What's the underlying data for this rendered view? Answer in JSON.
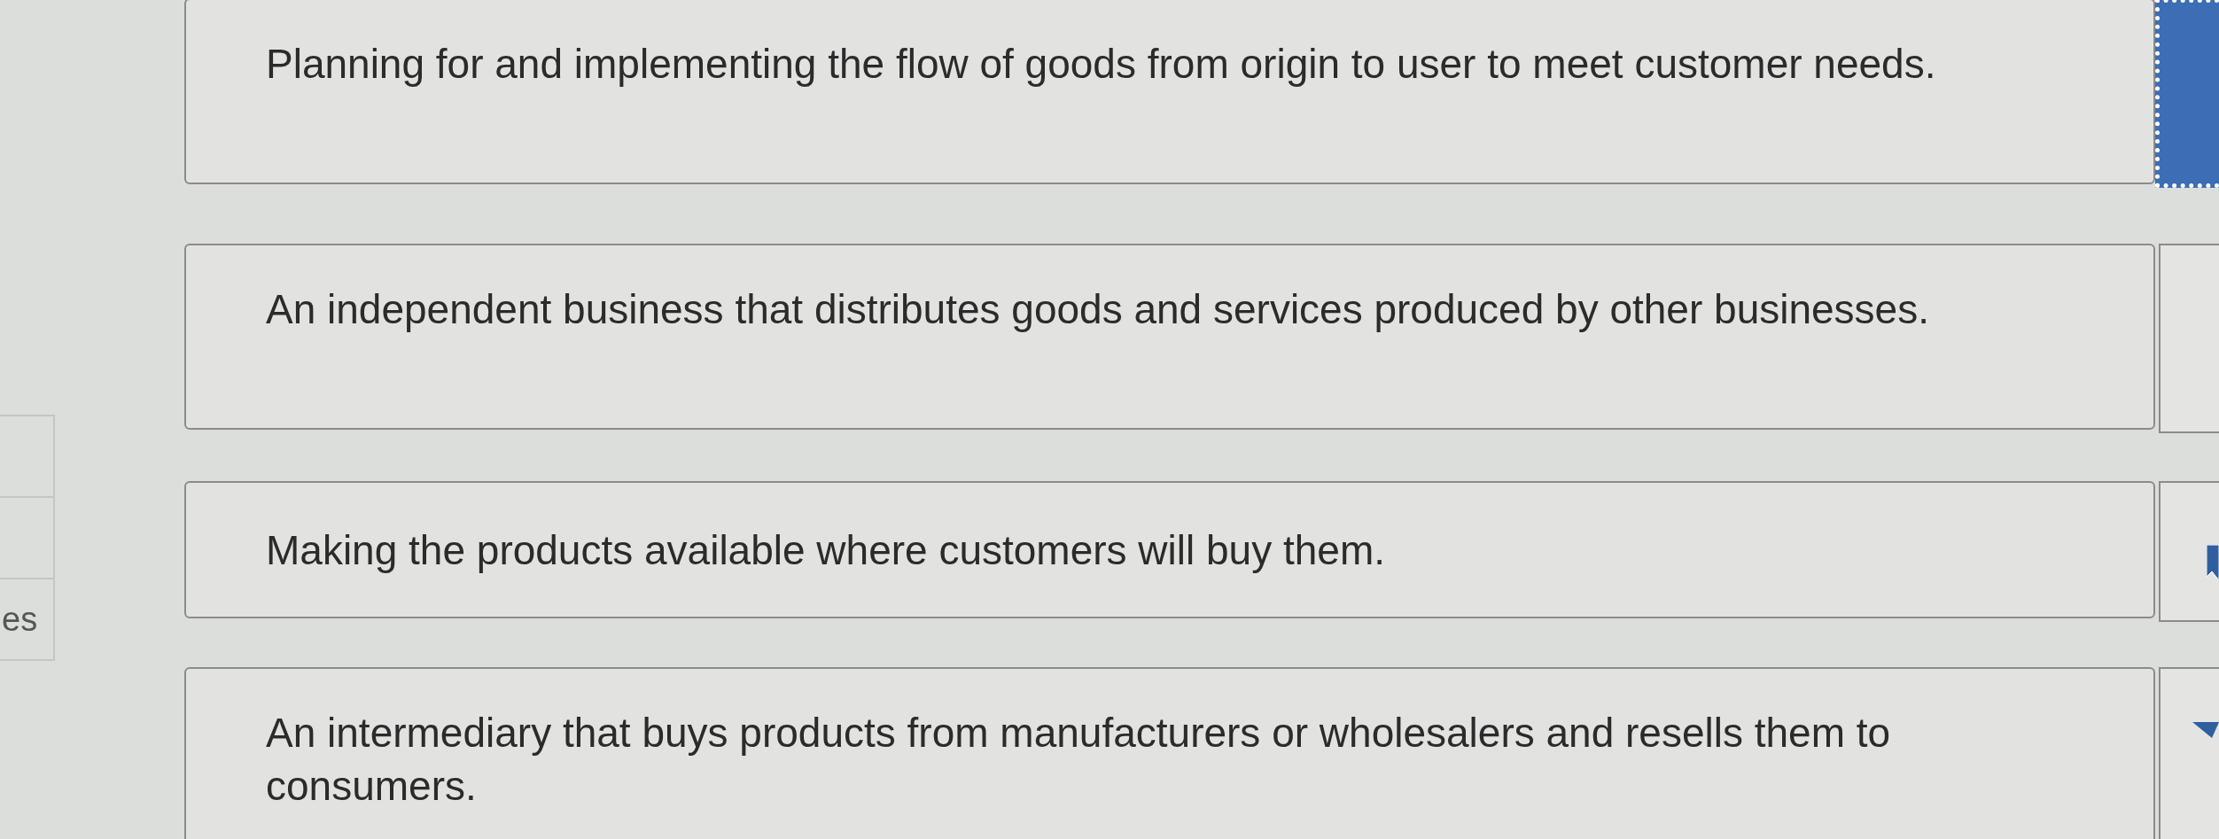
{
  "left_column": {
    "label": "es"
  },
  "definitions": [
    {
      "text": "Planning for and implementing the flow of goods from origin to user to meet customer needs."
    },
    {
      "text": "An independent business that distributes goods and services produced by other businesses."
    },
    {
      "text": "Making the products available where customers will buy them."
    },
    {
      "text": "An intermediary that buys products from manufacturers or wholesalers and resells them to consumers."
    }
  ],
  "drop_zones": [
    {
      "selected": true
    },
    {
      "selected": false
    },
    {
      "selected": false
    },
    {
      "selected": false
    }
  ]
}
